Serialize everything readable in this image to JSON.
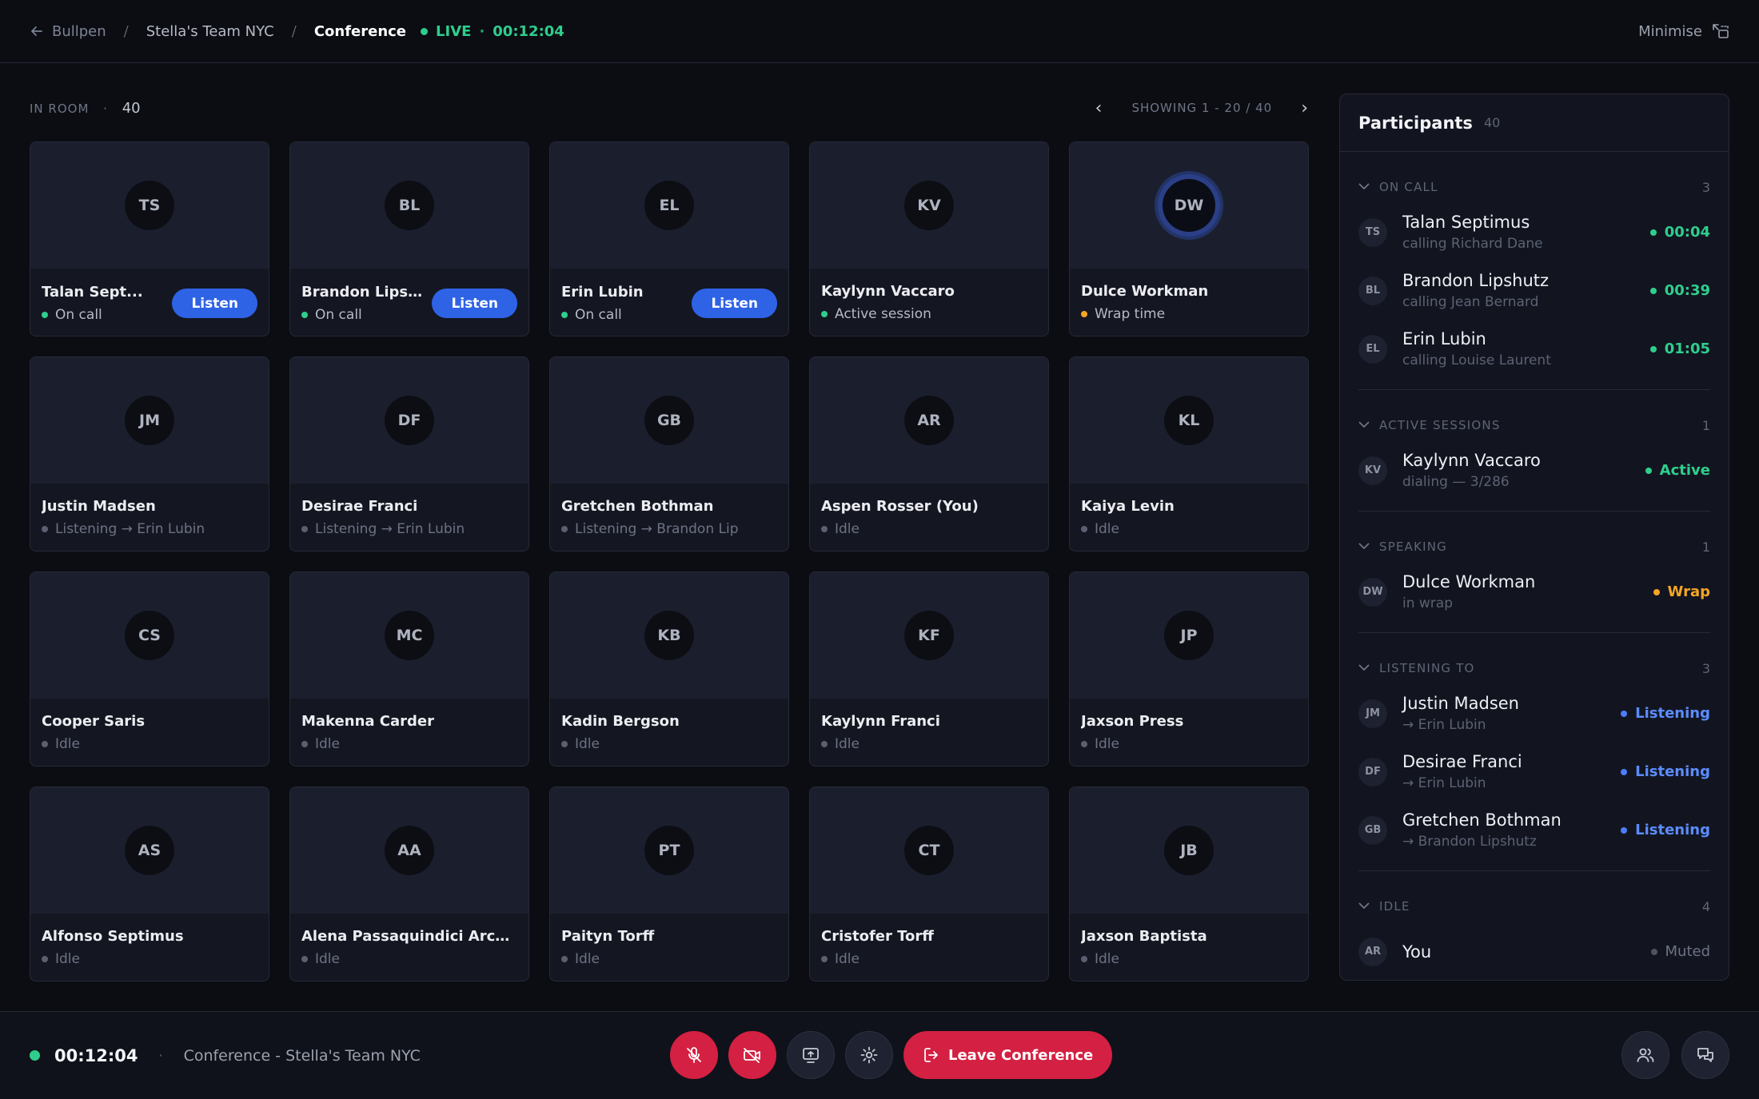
{
  "breadcrumb": {
    "back": "Bullpen",
    "team": "Stella's Team NYC",
    "current": "Conference"
  },
  "live": {
    "label": "LIVE",
    "time": "00:12:04"
  },
  "minimise_label": "Minimise",
  "room": {
    "label": "IN ROOM",
    "count": "40"
  },
  "pager": {
    "label": "SHOWING 1 - 20 / 40"
  },
  "listen_label": "Listen",
  "tiles": [
    {
      "initials": "TS",
      "name": "Talan Sept...",
      "status": "On call"
    },
    {
      "initials": "BL",
      "name": "Brandon Lips...",
      "status": "On call"
    },
    {
      "initials": "EL",
      "name": "Erin Lubin",
      "status": "On call"
    },
    {
      "initials": "KV",
      "name": "Kaylynn Vaccaro",
      "status": "Active session"
    },
    {
      "initials": "DW",
      "name": "Dulce Workman",
      "status": "Wrap time"
    },
    {
      "initials": "JM",
      "name": "Justin Madsen",
      "status": "Listening →  Erin Lubin"
    },
    {
      "initials": "DF",
      "name": "Desirae Franci",
      "status": "Listening →  Erin Lubin"
    },
    {
      "initials": "GB",
      "name": "Gretchen Bothman",
      "status": "Listening →  Brandon Lip"
    },
    {
      "initials": "AR",
      "name": "Aspen Rosser (You)",
      "status": "Idle"
    },
    {
      "initials": "KL",
      "name": "Kaiya Levin",
      "status": "Idle"
    },
    {
      "initials": "CS",
      "name": "Cooper Saris",
      "status": "Idle"
    },
    {
      "initials": "MC",
      "name": "Makenna Carder",
      "status": "Idle"
    },
    {
      "initials": "KB",
      "name": "Kadin Bergson",
      "status": "Idle"
    },
    {
      "initials": "KF",
      "name": "Kaylynn Franci",
      "status": "Idle"
    },
    {
      "initials": "JP",
      "name": "Jaxson Press",
      "status": "Idle"
    },
    {
      "initials": "AS",
      "name": "Alfonso Septimus",
      "status": "Idle"
    },
    {
      "initials": "AA",
      "name": "Alena Passaquindici Arcand",
      "status": "Idle"
    },
    {
      "initials": "PT",
      "name": "Paityn Torff",
      "status": "Idle"
    },
    {
      "initials": "CT",
      "name": "Cristofer Torff",
      "status": "Idle"
    },
    {
      "initials": "JB",
      "name": "Jaxson Baptista",
      "status": "Idle"
    }
  ],
  "panel": {
    "title": "Participants",
    "count": "40",
    "sections": [
      {
        "label": "ON CALL",
        "count": "3",
        "rows": [
          {
            "initials": "TS",
            "name": "Talan Septimus",
            "sub": "calling Richard Dane",
            "right": "00:04"
          },
          {
            "initials": "BL",
            "name": "Brandon Lipshutz",
            "sub": "calling Jean Bernard",
            "right": "00:39"
          },
          {
            "initials": "EL",
            "name": "Erin Lubin",
            "sub": "calling Louise Laurent",
            "right": "01:05"
          }
        ]
      },
      {
        "label": "ACTIVE SESSIONS",
        "count": "1",
        "rows": [
          {
            "initials": "KV",
            "name": "Kaylynn Vaccaro",
            "sub": "dialing — 3/286",
            "right": "Active"
          }
        ]
      },
      {
        "label": "SPEAKING",
        "count": "1",
        "rows": [
          {
            "initials": "DW",
            "name": "Dulce Workman",
            "sub": "in wrap",
            "right": "Wrap"
          }
        ]
      },
      {
        "label": "LISTENING TO",
        "count": "3",
        "rows": [
          {
            "initials": "JM",
            "name": "Justin Madsen",
            "sub": "→ Erin Lubin",
            "right": "Listening"
          },
          {
            "initials": "DF",
            "name": "Desirae Franci",
            "sub": "→ Erin Lubin",
            "right": "Listening"
          },
          {
            "initials": "GB",
            "name": "Gretchen Bothman",
            "sub": "→ Brandon Lipshutz",
            "right": "Listening"
          }
        ]
      },
      {
        "label": "IDLE",
        "count": "4",
        "rows": [
          {
            "initials": "AR",
            "name": "You",
            "sub": "",
            "right": "Muted"
          }
        ]
      }
    ]
  },
  "footer": {
    "timer": "00:12:04",
    "conference": "Conference - Stella's Team NYC",
    "leave_label": "Leave Conference"
  },
  "colors": {
    "green": "#2fce8d",
    "amber": "#f5a524",
    "blue": "#2f63e6",
    "red": "#d42042"
  }
}
